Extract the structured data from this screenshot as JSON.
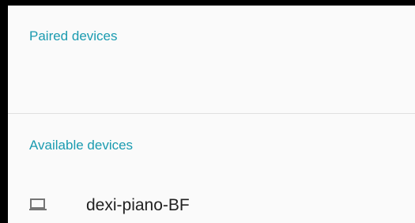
{
  "sections": {
    "paired": {
      "label": "Paired devices"
    },
    "available": {
      "label": "Available devices"
    }
  },
  "devices": [
    {
      "name": "dexi-piano-BF",
      "icon": "laptop-icon"
    }
  ],
  "colors": {
    "accent": "#1a9bb0",
    "text_primary": "#212121",
    "icon": "#757575",
    "background": "#fafafa",
    "divider": "#e0e0e0"
  }
}
